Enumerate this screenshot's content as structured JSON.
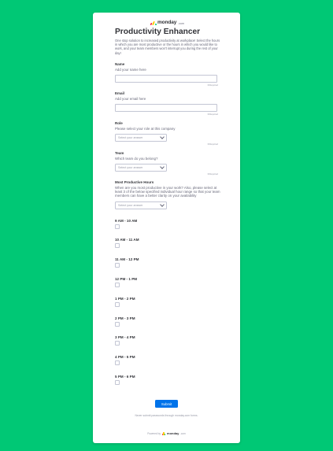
{
  "brand": {
    "name": "monday",
    "suffix": ".com",
    "colors": [
      "#f62b54",
      "#ffcc00",
      "#00ca72"
    ]
  },
  "form": {
    "title": "Productivity Enhancer",
    "description": "One stop solution to increased productivity at workplace! Select the hours in which you are most productive or the hours in which you would like to work, and your team members won't interrupt you during the rest of your day!",
    "name": {
      "label": "Name",
      "sublabel": "Add your name here",
      "value": "",
      "required": "∗Required"
    },
    "email": {
      "label": "Email",
      "sublabel": "Add your email here",
      "value": "",
      "required": "∗Required"
    },
    "role": {
      "label": "Role",
      "sublabel": "Please select your role at this company",
      "placeholder": "Select your answer",
      "required": "∗Required"
    },
    "team": {
      "label": "Team",
      "sublabel": "Which team do you belong?",
      "placeholder": "Select your answer",
      "required": "∗Required"
    },
    "hours": {
      "label": "Most Productive Hours",
      "sublabel": "When are you most productive in your work? Also, please select at least 3 of the below specified individual hour range so that your team members can have a better clarity on your availability",
      "placeholder": "Select your answer"
    },
    "slots": [
      "9 AM - 10 AM",
      "10 AM - 11 AM",
      "11 AM - 12 PM",
      "12 PM - 1 PM",
      "1 PM - 2 PM",
      "2 PM - 3 PM",
      "3 PM - 4 PM",
      "4 PM - 5 PM",
      "5 PM - 6 PM"
    ],
    "submit_label": "Submit",
    "never_submit": "Never submit passwords through monday.com forms.",
    "powered_by": "Powered by",
    "powered_brand": "monday",
    "powered_suffix": ".com"
  },
  "colors": {
    "background": "#00c875",
    "accent": "#0073ea"
  }
}
